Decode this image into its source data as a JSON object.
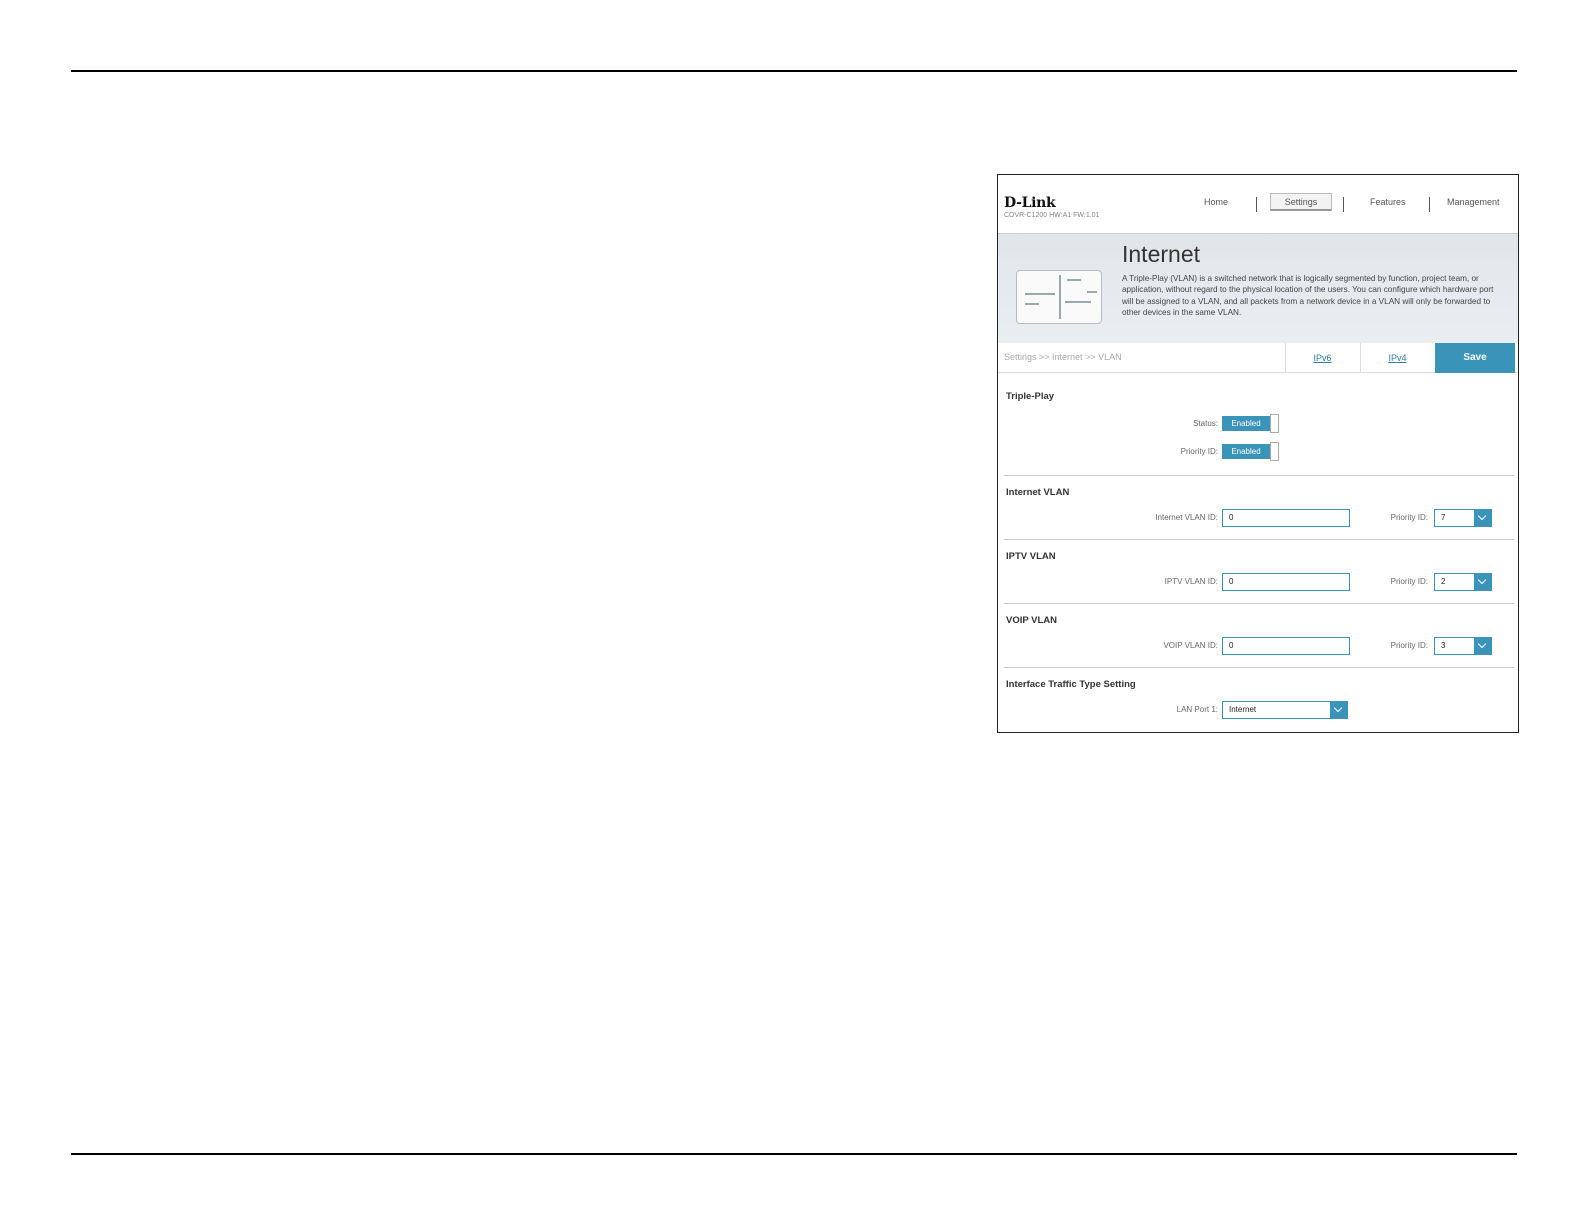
{
  "header": {
    "logo": "D-Link",
    "model": "COVR-C1200 HW:A1 FW:1.01",
    "nav": [
      "Home",
      "Settings",
      "Features",
      "Management"
    ]
  },
  "banner": {
    "title": "Internet",
    "description": "A Triple-Play (VLAN) is a switched network that is logically segmented by function, project team, or application, without regard to the physical location of the users. You can configure which hardware port will be assigned to a VLAN, and all packets from a network device in a VLAN will only be forwarded to other devices in the same VLAN."
  },
  "breadcrumb": "Settings >> Internet >> VLAN",
  "tabs": {
    "ipv6": "IPv6",
    "ipv4": "IPv4",
    "save": "Save"
  },
  "triple_play": {
    "title": "Triple-Play",
    "status_label": "Status:",
    "status_value": "Enabled",
    "priority_label": "Priority ID:",
    "priority_value": "Enabled"
  },
  "internet_vlan": {
    "title": "Internet VLAN",
    "id_label": "Internet VLAN ID:",
    "id_value": "0",
    "priority_label": "Priority ID:",
    "priority_value": "7"
  },
  "iptv_vlan": {
    "title": "IPTV VLAN",
    "id_label": "IPTV VLAN ID:",
    "id_value": "0",
    "priority_label": "Priority ID:",
    "priority_value": "2"
  },
  "voip_vlan": {
    "title": "VOIP VLAN",
    "id_label": "VOIP VLAN ID:",
    "id_value": "0",
    "priority_label": "Priority ID:",
    "priority_value": "3"
  },
  "interface": {
    "title": "Interface Traffic Type Setting",
    "lan1_label": "LAN Port 1:",
    "lan1_value": "Internet"
  },
  "colors": {
    "accent": "#3a93b8"
  }
}
